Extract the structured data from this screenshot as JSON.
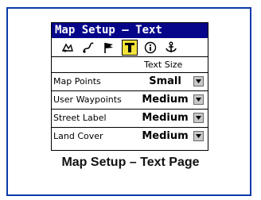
{
  "window": {
    "title": "Map Setup – Text"
  },
  "tabs": [
    {
      "icon": "map-detail-icon"
    },
    {
      "icon": "route-icon"
    },
    {
      "icon": "flag-icon"
    },
    {
      "icon": "text-icon",
      "active": true
    },
    {
      "icon": "info-icon"
    },
    {
      "icon": "anchor-icon"
    }
  ],
  "column_header": "Text Size",
  "rows": [
    {
      "label": "Map Points",
      "value": "Small"
    },
    {
      "label": "User Waypoints",
      "value": "Medium"
    },
    {
      "label": "Street Label",
      "value": "Medium"
    },
    {
      "label": "Land Cover",
      "value": "Medium"
    }
  ],
  "caption": "Map Setup – Text Page",
  "colors": {
    "title_bg": "#06068a",
    "active_tab": "#f3e23a",
    "frame": "#0a3aa8"
  }
}
